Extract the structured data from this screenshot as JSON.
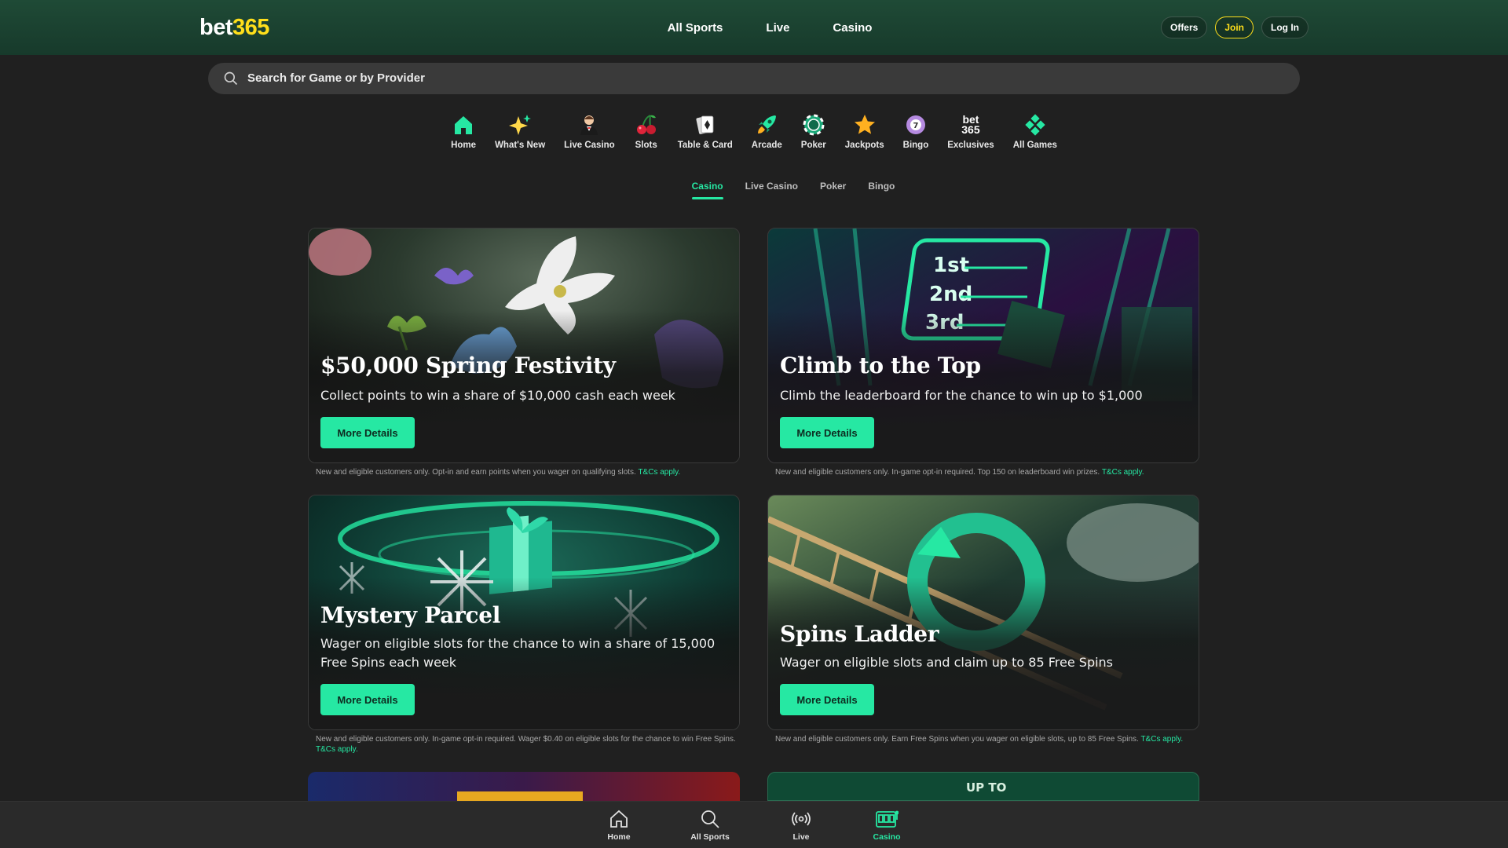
{
  "header": {
    "logo_part1": "bet",
    "logo_part2": "365",
    "nav": [
      "All Sports",
      "Live",
      "Casino"
    ],
    "buttons": {
      "offers": "Offers",
      "join": "Join",
      "login": "Log In"
    }
  },
  "search": {
    "placeholder": "Search for Game or by Provider"
  },
  "categories": [
    {
      "label": "Home",
      "icon": "home-icon"
    },
    {
      "label": "What's New",
      "icon": "sparkle-icon"
    },
    {
      "label": "Live Casino",
      "icon": "dealer-icon"
    },
    {
      "label": "Slots",
      "icon": "cherries-icon"
    },
    {
      "label": "Table & Card",
      "icon": "cards-icon"
    },
    {
      "label": "Arcade",
      "icon": "rocket-icon"
    },
    {
      "label": "Poker",
      "icon": "poker-chip-icon"
    },
    {
      "label": "Jackpots",
      "icon": "star-icon"
    },
    {
      "label": "Bingo",
      "icon": "bingo-ball-icon"
    },
    {
      "label": "Exclusives",
      "icon": "bet365-badge-icon",
      "badge_top": "bet",
      "badge_bottom": "365"
    },
    {
      "label": "All Games",
      "icon": "grid-icon"
    }
  ],
  "tabs": [
    "Casino",
    "Live Casino",
    "Poker",
    "Bingo"
  ],
  "active_tab": "Casino",
  "promos": [
    {
      "title": "$50,000 Spring Festivity",
      "subtitle": "Collect points to win a share of $10,000 cash each week",
      "button": "More Details",
      "terms": "New and eligible customers only. Opt-in and earn points when you wager on qualifying slots.",
      "terms_link": "T&Cs apply."
    },
    {
      "title": "Climb to the Top",
      "subtitle": "Climb the leaderboard for the chance to win up to $1,000",
      "button": "More Details",
      "terms": "New and eligible customers only. In-game opt-in required. Top 150 on leaderboard win prizes.",
      "terms_link": "T&Cs apply.",
      "art_labels": [
        "1st",
        "2nd",
        "3rd"
      ]
    },
    {
      "title": "Mystery Parcel",
      "subtitle": "Wager on eligible slots for the chance to win a share of 15,000 Free Spins each week",
      "button": "More Details",
      "terms": "New and eligible customers only. In-game opt-in required. Wager $0.40 on eligible slots for the chance to win Free Spins.",
      "terms_link": "T&Cs apply."
    },
    {
      "title": "Spins Ladder",
      "subtitle": "Wager on eligible slots and claim up to 85 Free Spins",
      "button": "More Details",
      "terms": "New and eligible customers only. Earn Free Spins when you wager on eligible slots, up to 85 Free Spins.",
      "terms_link": "T&Cs apply."
    }
  ],
  "partial_cards": {
    "right_text": "UP TO"
  },
  "bottom_nav": [
    {
      "label": "Home",
      "icon": "home-outline-icon"
    },
    {
      "label": "All Sports",
      "icon": "search-icon"
    },
    {
      "label": "Live",
      "icon": "broadcast-icon"
    },
    {
      "label": "Casino",
      "icon": "slot-machine-icon",
      "active": true
    }
  ],
  "colors": {
    "accent": "#26e8a3",
    "header": "#1f4a36",
    "logo_yellow": "#ffdf1b",
    "background": "#202020"
  }
}
